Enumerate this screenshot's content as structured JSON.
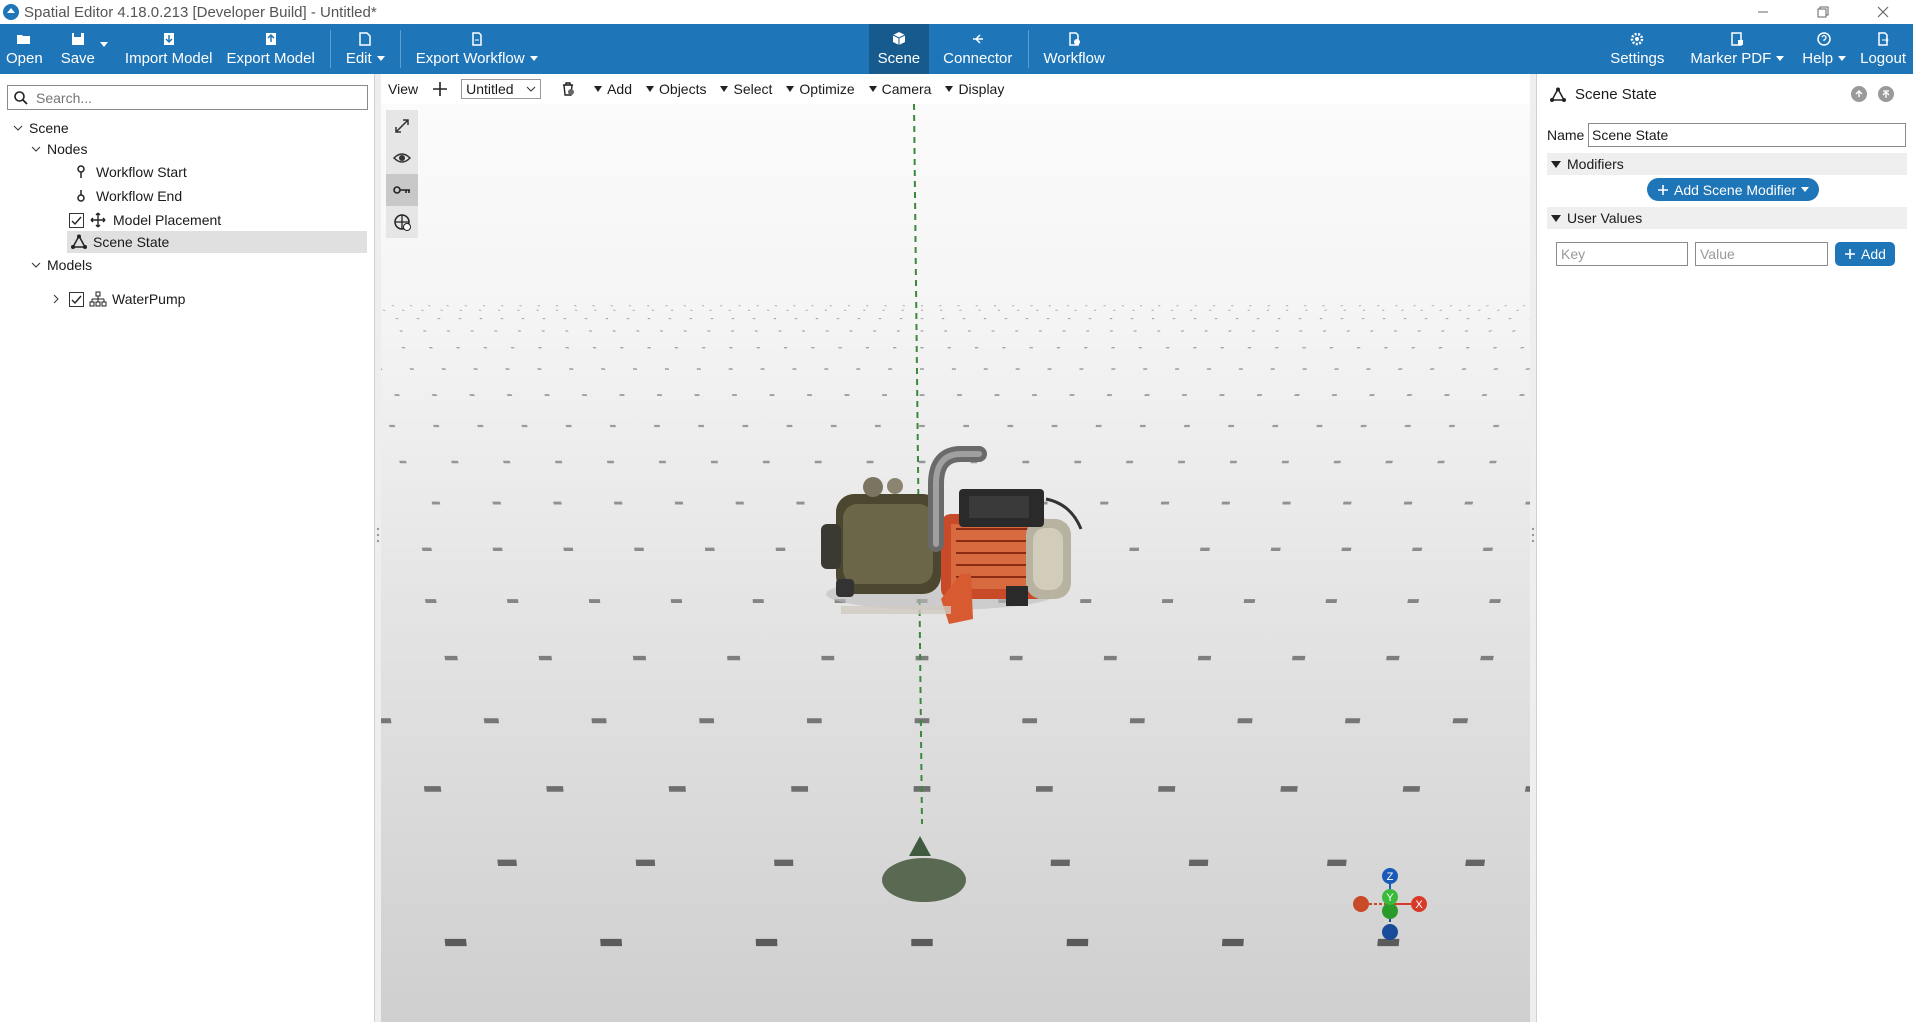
{
  "window": {
    "title": "Spatial Editor 4.18.0.213 [Developer Build] - Untitled*"
  },
  "toolbar": {
    "left": [
      {
        "label": "Open",
        "icon": "folder-open-icon"
      },
      {
        "label": "Save",
        "icon": "save-icon"
      },
      {
        "label": "Import Model",
        "icon": "import-icon"
      },
      {
        "label": "Export Model",
        "icon": "export-icon"
      },
      {
        "label": "Edit",
        "icon": "edit-icon"
      },
      {
        "label": "Export Workflow",
        "icon": "document-icon"
      }
    ],
    "center": [
      {
        "label": "Scene",
        "icon": "cube-icon",
        "active": true
      },
      {
        "label": "Connector",
        "icon": "connector-icon"
      },
      {
        "label": "Workflow",
        "icon": "workflow-icon"
      }
    ],
    "right": [
      {
        "label": "Settings",
        "icon": "gear-icon"
      },
      {
        "label": "Marker PDF",
        "icon": "marker-icon"
      },
      {
        "label": "Help",
        "icon": "help-icon"
      },
      {
        "label": "Logout",
        "icon": "logout-icon"
      }
    ],
    "accent_color": "#1e75b8"
  },
  "left_panel": {
    "search_placeholder": "Search...",
    "tree": {
      "scene": "Scene",
      "nodes": "Nodes",
      "workflow_start": "Workflow Start",
      "workflow_end": "Workflow End",
      "model_placement": "Model Placement",
      "scene_state": "Scene State",
      "models": "Models",
      "water_pump": "WaterPump"
    }
  },
  "viewport": {
    "toolbar": {
      "view": "View",
      "selected_view": "Untitled",
      "add": "Add",
      "objects": "Objects",
      "select": "Select",
      "optimize": "Optimize",
      "camera": "Camera",
      "display": "Display"
    },
    "axes": {
      "x": "X",
      "y": "Y",
      "z": "Z"
    }
  },
  "right_panel": {
    "title": "Scene State",
    "name_label": "Name",
    "name_value": "Scene State",
    "modifiers_label": "Modifiers",
    "add_modifier_label": "Add Scene Modifier",
    "user_values_label": "User Values",
    "key_placeholder": "Key",
    "value_placeholder": "Value",
    "add_label": "Add"
  }
}
